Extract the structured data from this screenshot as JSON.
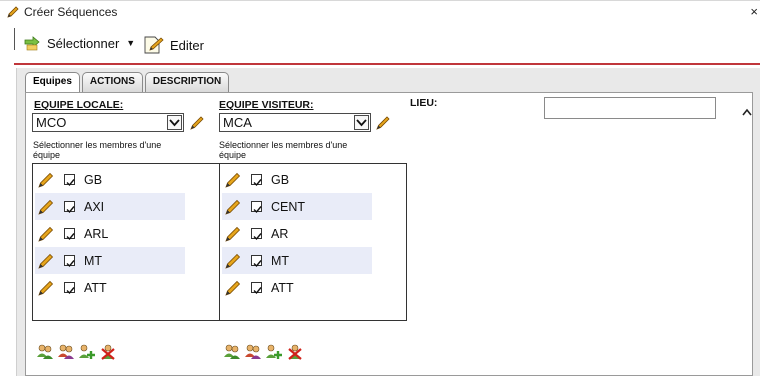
{
  "window": {
    "title": "Créer Séquences",
    "close_glyph": "×"
  },
  "toolbar": {
    "select_label": "Sélectionner",
    "edit_label": "Editer"
  },
  "tabs": [
    {
      "label": "Equipes",
      "active": true
    },
    {
      "label": "ACTIONS",
      "active": false
    },
    {
      "label": "DESCRIPTION",
      "active": false
    }
  ],
  "home_team": {
    "label": "EQUIPE LOCALE:",
    "selected": "MCO",
    "members_hint_line1": "Sélectionner les membres d'une",
    "members_hint_line2": "équipe",
    "members": [
      {
        "name": "GB",
        "checked": true
      },
      {
        "name": "AXI",
        "checked": true
      },
      {
        "name": "ARL",
        "checked": true
      },
      {
        "name": "MT",
        "checked": true
      },
      {
        "name": "ATT",
        "checked": true
      }
    ]
  },
  "away_team": {
    "label": "EQUIPE VISITEUR:",
    "selected": "MCA",
    "members_hint_line1": "Sélectionner les membres d'une",
    "members_hint_line2": "équipe",
    "members": [
      {
        "name": "GB",
        "checked": true
      },
      {
        "name": "CENT",
        "checked": true
      },
      {
        "name": "AR",
        "checked": true
      },
      {
        "name": "MT",
        "checked": true
      },
      {
        "name": "ATT",
        "checked": true
      }
    ]
  },
  "location": {
    "label": "LIEU:",
    "value": ""
  },
  "member_actions": [
    "select-all-users-icon",
    "select-group-icon",
    "add-user-icon",
    "remove-user-icon"
  ],
  "colors": {
    "accent_rule": "#c0363b",
    "row_alt": "#e9ecf8",
    "tab_panel": "#e9e9e9",
    "pencil": "#e0a21a"
  }
}
